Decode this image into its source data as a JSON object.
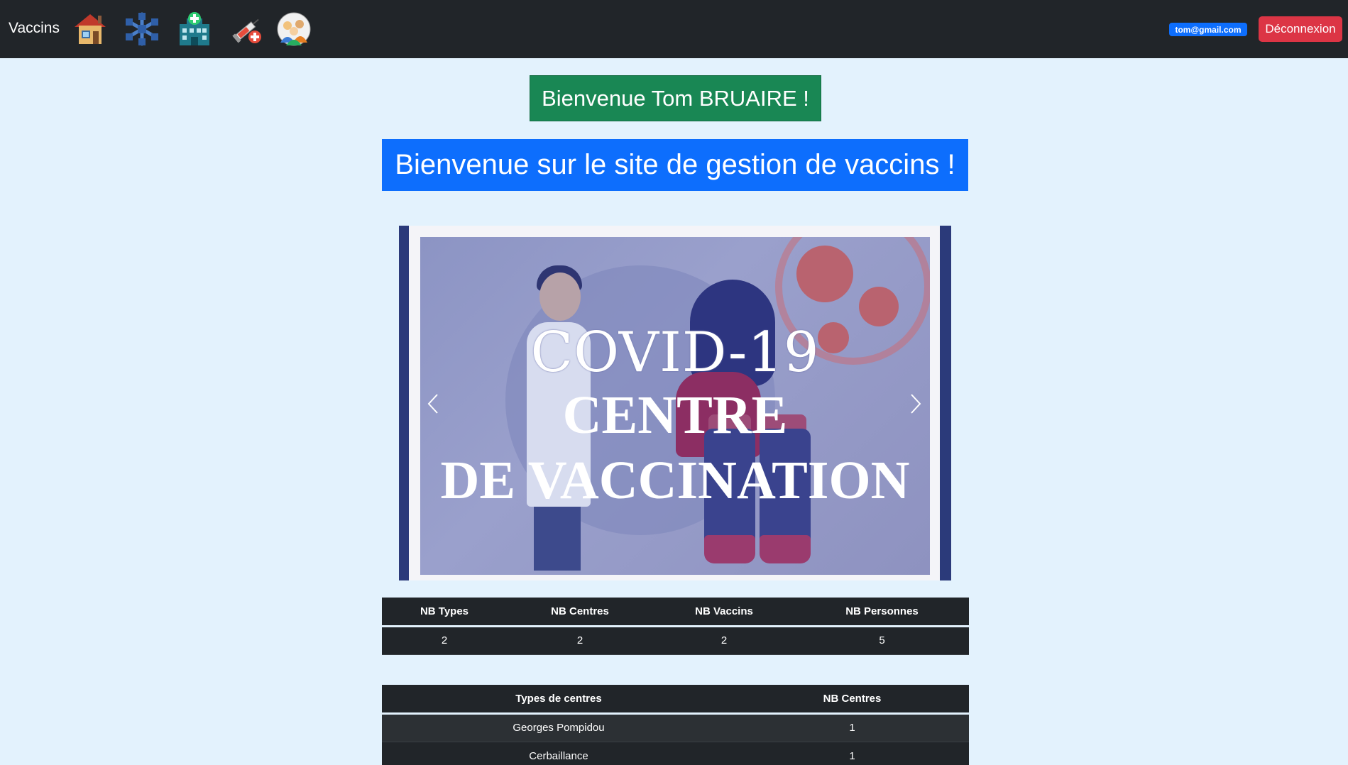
{
  "navbar": {
    "brand": "Vaccins",
    "icons": [
      "home-icon",
      "snowflake-icon",
      "hospital-icon",
      "syringe-icon",
      "people-icon"
    ],
    "user_email": "tom@gmail.com",
    "logout_label": "Déconnexion"
  },
  "welcome": {
    "user": "Bienvenue Tom BRUAIRE !",
    "site": "Bienvenue sur le site de gestion de vaccins !"
  },
  "carousel": {
    "line1": "COVID-19",
    "line2": "CENTRE",
    "line3": "DE VACCINATION"
  },
  "stats_table": {
    "headers": [
      "NB Types",
      "NB Centres",
      "NB Vaccins",
      "NB Personnes"
    ],
    "values": [
      "2",
      "2",
      "2",
      "5"
    ]
  },
  "centres_table": {
    "headers": [
      "Types de centres",
      "NB Centres"
    ],
    "rows": [
      [
        "Georges Pompidou",
        "1"
      ],
      [
        "Cerbaillance",
        "1"
      ]
    ]
  },
  "colors": {
    "navbar": "#212529",
    "background": "#e3f2fd",
    "success": "#198754",
    "primary": "#0d6efd",
    "danger": "#dc3545"
  }
}
